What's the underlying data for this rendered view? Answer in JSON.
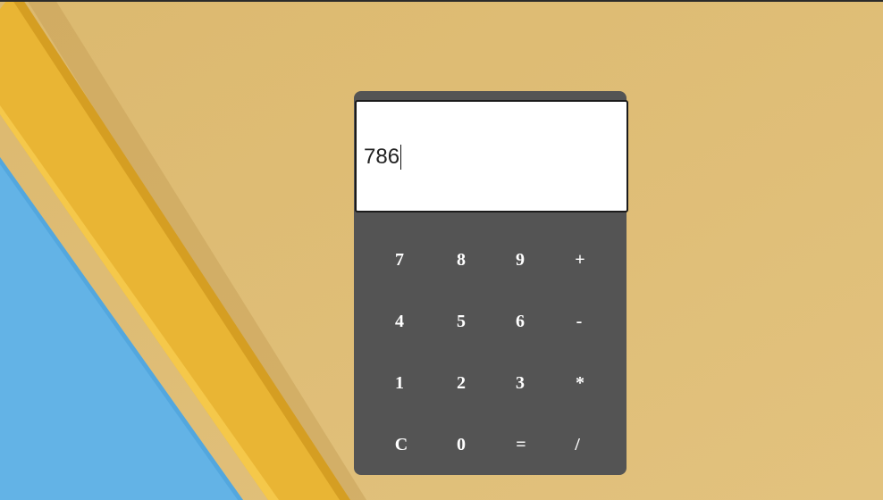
{
  "calculator": {
    "display_value": "786",
    "keys": [
      "7",
      "8",
      "9",
      "+",
      "4",
      "5",
      "6",
      "-",
      "1",
      "2",
      "3",
      "*",
      "C",
      "0",
      "=",
      "/"
    ]
  },
  "colors": {
    "background_paper": "#dfbd76",
    "yellow_strip": "#e9b534",
    "blue_paper": "#63b3e6",
    "calculator_body": "#545454",
    "display_background": "#ffffff",
    "key_text": "#ffffff"
  }
}
